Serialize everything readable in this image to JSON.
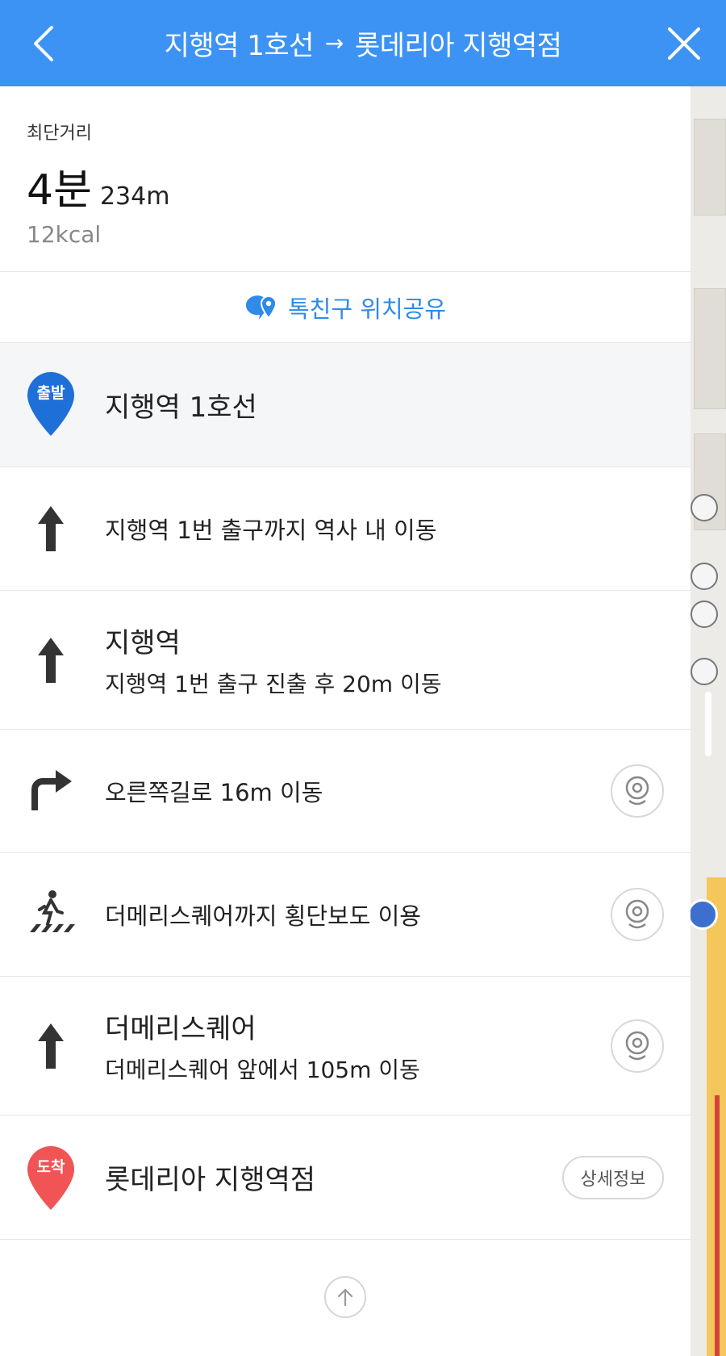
{
  "header": {
    "origin": "지행역 1호선",
    "separator": "→",
    "destination": "롯데리아 지행역점",
    "back_icon": "chevron-left-icon",
    "close_icon": "close-icon"
  },
  "summary": {
    "route_type": "최단거리",
    "duration": "4분",
    "distance": "234m",
    "calories": "12kcal"
  },
  "share": {
    "label": "톡친구 위치공유",
    "icon": "talk-location-icon",
    "color": "#2f8ae8"
  },
  "start": {
    "badge": "출발",
    "name": "지행역 1호선",
    "color": "#1f6fd8"
  },
  "steps": [
    {
      "icon": "arrow-up-icon",
      "text": "지행역 1번 출구까지 역사 내 이동"
    },
    {
      "icon": "arrow-up-icon",
      "title": "지행역",
      "text": "지행역 1번 출구 진출 후 20m 이동"
    },
    {
      "icon": "turn-right-icon",
      "text": "오른쪽길로 16m 이동",
      "view": true
    },
    {
      "icon": "crosswalk-icon",
      "text": "더메리스퀘어까지 횡단보도 이용",
      "view": true
    },
    {
      "icon": "arrow-up-icon",
      "title": "더메리스퀘어",
      "text": "더메리스퀘어 앞에서 105m 이동",
      "view": true
    }
  ],
  "end": {
    "badge": "도착",
    "name": "롯데리아 지행역점",
    "detail_label": "상세정보",
    "color": "#f05454"
  },
  "colors": {
    "header_bg": "#3d93f3"
  }
}
